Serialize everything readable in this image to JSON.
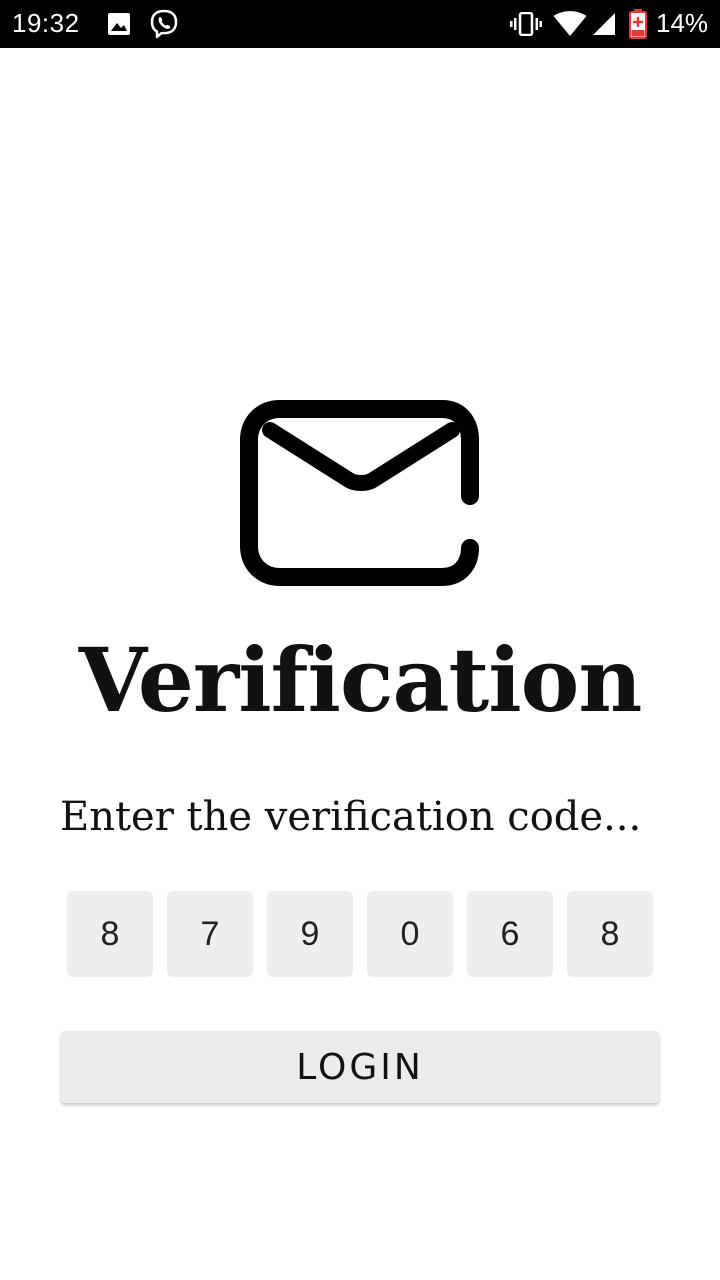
{
  "status_bar": {
    "time": "19:32",
    "battery_percent": "14%",
    "icons": [
      "image-icon",
      "viber-icon",
      "vibrate-icon",
      "wifi-icon",
      "signal-icon",
      "battery-charging-icon"
    ]
  },
  "main": {
    "icon": "mail-icon",
    "title": "Verification",
    "subtitle": "Enter the verification code...",
    "code_digits": [
      "8",
      "7",
      "9",
      "0",
      "6",
      "8"
    ],
    "login_label": "LOGIN"
  },
  "colors": {
    "status_bar_bg": "#000000",
    "background": "#ffffff",
    "input_bg": "#eeeeee",
    "button_bg": "#ececec",
    "battery_accent": "#e53935"
  }
}
